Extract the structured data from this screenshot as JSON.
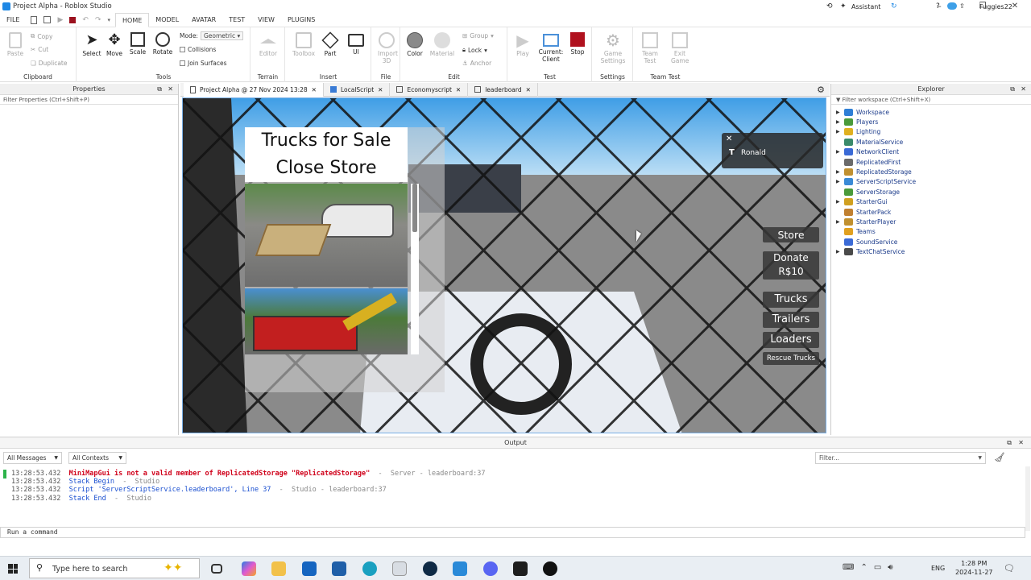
{
  "window": {
    "title": "Project Alpha - Roblox Studio"
  },
  "titlebar": {
    "assistant_label": "Assistant",
    "user_name": "Fuggies22"
  },
  "menu": {
    "items": [
      "FILE",
      "HOME",
      "MODEL",
      "AVATAR",
      "TEST",
      "VIEW",
      "PLUGINS"
    ],
    "active": "HOME"
  },
  "ribbon": {
    "clipboard": {
      "label": "Clipboard",
      "paste": "Paste",
      "copy": "Copy",
      "cut": "Cut",
      "duplicate": "Duplicate"
    },
    "tools": {
      "label": "Tools",
      "select": "Select",
      "move": "Move",
      "scale": "Scale",
      "rotate": "Rotate",
      "mode_label": "Mode:",
      "mode_value": "Geometric",
      "collisions": "Collisions",
      "join_surfaces": "Join Surfaces"
    },
    "terrain": {
      "label": "Terrain",
      "editor": "Editor"
    },
    "insert": {
      "label": "Insert",
      "toolbox": "Toolbox",
      "part": "Part",
      "ui": "UI"
    },
    "file": {
      "label": "File",
      "import3d": "Import 3D"
    },
    "edit": {
      "label": "Edit",
      "color": "Color",
      "material": "Material",
      "group": "Group",
      "lock": "Lock",
      "anchor": "Anchor"
    },
    "test": {
      "label": "Test",
      "play": "Play",
      "current_client": "Current: Client",
      "stop": "Stop"
    },
    "settings": {
      "label": "Settings",
      "game_settings": "Game Settings"
    },
    "team_test": {
      "label": "Team Test",
      "team_test": "Team Test",
      "exit_game": "Exit Game"
    }
  },
  "properties": {
    "title": "Properties",
    "filter_placeholder": "Filter Properties (Ctrl+Shift+P)"
  },
  "tabs": [
    {
      "label": "Project Alpha @ 27 Nov 2024 13:28"
    },
    {
      "label": "LocalScript"
    },
    {
      "label": "Economyscript"
    },
    {
      "label": "leaderboard"
    }
  ],
  "game": {
    "store_title": "Trucks for Sale",
    "close_store": "Close Store",
    "player_name": "Ronald",
    "buttons": [
      "Store",
      "Donate R$10",
      "Trucks",
      "Trailers",
      "Loaders",
      "Rescue Trucks"
    ]
  },
  "explorer": {
    "title": "Explorer",
    "filter_placeholder": "Filter workspace (Ctrl+Shift+X)",
    "items": [
      {
        "label": "Workspace",
        "color": "#2f7fd6",
        "expandable": true
      },
      {
        "label": "Players",
        "color": "#4a9a3a",
        "expandable": true
      },
      {
        "label": "Lighting",
        "color": "#e0b020",
        "expandable": true
      },
      {
        "label": "MaterialService",
        "color": "#3a8a6a",
        "expandable": false
      },
      {
        "label": "NetworkClient",
        "color": "#3a6ad6",
        "expandable": true
      },
      {
        "label": "ReplicatedFirst",
        "color": "#6a6a6a",
        "expandable": false
      },
      {
        "label": "ReplicatedStorage",
        "color": "#c09030",
        "expandable": true
      },
      {
        "label": "ServerScriptService",
        "color": "#3a8ad6",
        "expandable": true
      },
      {
        "label": "ServerStorage",
        "color": "#4a9a3a",
        "expandable": false
      },
      {
        "label": "StarterGui",
        "color": "#d0a020",
        "expandable": true
      },
      {
        "label": "StarterPack",
        "color": "#c08030",
        "expandable": false
      },
      {
        "label": "StarterPlayer",
        "color": "#c09030",
        "expandable": true
      },
      {
        "label": "Teams",
        "color": "#e0a020",
        "expandable": false
      },
      {
        "label": "SoundService",
        "color": "#3a6ad6",
        "expandable": false
      },
      {
        "label": "TextChatService",
        "color": "#4a4a4a",
        "expandable": true
      }
    ]
  },
  "output": {
    "title": "Output",
    "messages_filter": "All Messages",
    "contexts_filter": "All Contexts",
    "filter_placeholder": "Filter...",
    "lines": [
      {
        "time": "13:28:53.432",
        "text": "MiniMapGui is not a valid member of ReplicatedStorage \"ReplicatedStorage\"",
        "suffix": "  -  Server - leaderboard:37",
        "type": "error"
      },
      {
        "time": "13:28:53.432",
        "text": "Stack Begin",
        "suffix": "  -  Studio",
        "type": "info"
      },
      {
        "time": "13:28:53.432",
        "text": "Script 'ServerScriptService.leaderboard', Line 37",
        "suffix": "  -  Studio - leaderboard:37",
        "type": "info"
      },
      {
        "time": "13:28:53.432",
        "text": "Stack End",
        "suffix": "  -  Studio",
        "type": "info"
      }
    ],
    "command_placeholder": "Run a command"
  },
  "taskbar": {
    "search_placeholder": "Type here to search",
    "language": "ENG",
    "time": "1:28 PM",
    "date": "2024-11-27"
  }
}
